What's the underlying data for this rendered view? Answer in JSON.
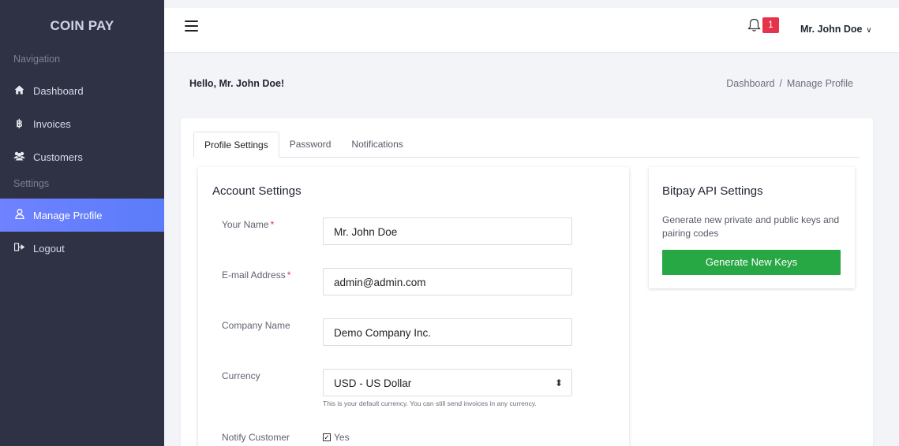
{
  "sidebar": {
    "brand": "COIN PAY",
    "sections": [
      {
        "heading": "Navigation",
        "items": [
          {
            "label": "Dashboard",
            "icon": "home-icon"
          },
          {
            "label": "Invoices",
            "icon": "bitcoin-icon"
          },
          {
            "label": "Customers",
            "icon": "users-icon"
          }
        ]
      },
      {
        "heading": "Settings",
        "items": [
          {
            "label": "Manage Profile",
            "icon": "user-icon",
            "active": true
          },
          {
            "label": "Logout",
            "icon": "logout-icon"
          }
        ]
      }
    ]
  },
  "topbar": {
    "notification_count": "1",
    "user_name": "Mr. John Doe"
  },
  "page": {
    "greeting": "Hello, Mr. John Doe!",
    "breadcrumb": {
      "parent": "Dashboard",
      "separator": "/",
      "current": "Manage Profile"
    }
  },
  "tabs": [
    {
      "label": "Profile Settings",
      "active": true
    },
    {
      "label": "Password"
    },
    {
      "label": "Notifications"
    }
  ],
  "account": {
    "title": "Account Settings",
    "name_label": "Your Name",
    "name_value": "Mr. John Doe",
    "email_label": "E-mail Address",
    "email_value": "admin@admin.com",
    "company_label": "Company Name",
    "company_value": "Demo Company Inc.",
    "currency_label": "Currency",
    "currency_value": "USD - US Dollar",
    "currency_help": "This is your default currency. You can still send invoices in any currency.",
    "notify_label": "Notify Customer",
    "notify_option": "Yes",
    "required_mark": "*"
  },
  "bitpay": {
    "title": "Bitpay API Settings",
    "description": "Generate new private and public keys and pairing codes",
    "button": "Generate New Keys"
  },
  "colors": {
    "sidebar_bg": "#2f3245",
    "active_nav": "#6f82ff",
    "badge": "#e4334a",
    "success_button": "#28a745"
  }
}
